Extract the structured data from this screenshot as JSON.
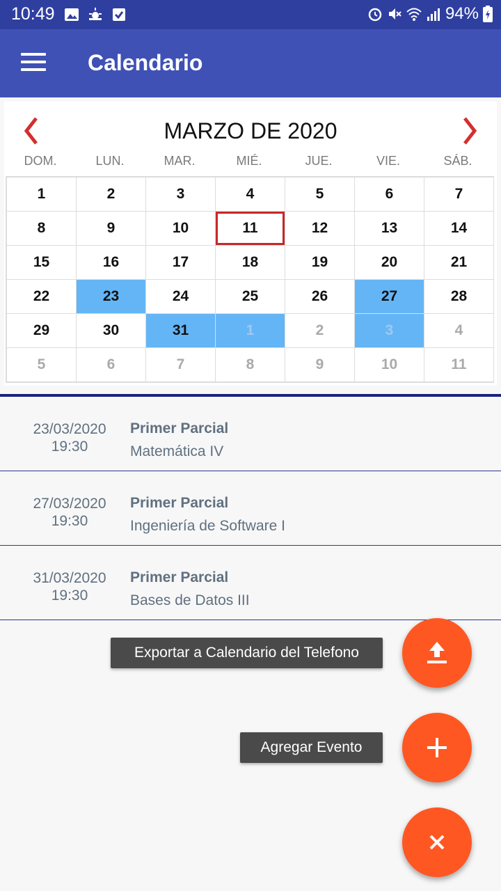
{
  "status_bar": {
    "time": "10:49",
    "battery": "94%",
    "left_icons": [
      "gallery-icon",
      "weather-icon",
      "check-icon"
    ],
    "right_icons": [
      "alarm-icon",
      "mute-icon",
      "wifi-icon",
      "signal-icon",
      "battery-icon"
    ]
  },
  "app_bar": {
    "title": "Calendario",
    "menu_icon": "hamburger-menu-icon",
    "color": "#3f51b5"
  },
  "calendar": {
    "month_label": "MARZO DE 2020",
    "weekdays": [
      "DOM.",
      "LUN.",
      "MAR.",
      "MIÉ.",
      "JUE.",
      "VIE.",
      "SÁB."
    ],
    "selected_day": "11",
    "today_border_color": "#c62828",
    "event_color": "#64b5f6",
    "days": [
      {
        "label": "1",
        "other": false,
        "event": false
      },
      {
        "label": "2",
        "other": false,
        "event": false
      },
      {
        "label": "3",
        "other": false,
        "event": false
      },
      {
        "label": "4",
        "other": false,
        "event": false
      },
      {
        "label": "5",
        "other": false,
        "event": false
      },
      {
        "label": "6",
        "other": false,
        "event": false
      },
      {
        "label": "7",
        "other": false,
        "event": false
      },
      {
        "label": "8",
        "other": false,
        "event": false
      },
      {
        "label": "9",
        "other": false,
        "event": false
      },
      {
        "label": "10",
        "other": false,
        "event": false
      },
      {
        "label": "11",
        "other": false,
        "event": false,
        "today": true
      },
      {
        "label": "12",
        "other": false,
        "event": false
      },
      {
        "label": "13",
        "other": false,
        "event": false
      },
      {
        "label": "14",
        "other": false,
        "event": false
      },
      {
        "label": "15",
        "other": false,
        "event": false
      },
      {
        "label": "16",
        "other": false,
        "event": false
      },
      {
        "label": "17",
        "other": false,
        "event": false
      },
      {
        "label": "18",
        "other": false,
        "event": false
      },
      {
        "label": "19",
        "other": false,
        "event": false
      },
      {
        "label": "20",
        "other": false,
        "event": false
      },
      {
        "label": "21",
        "other": false,
        "event": false
      },
      {
        "label": "22",
        "other": false,
        "event": false
      },
      {
        "label": "23",
        "other": false,
        "event": true
      },
      {
        "label": "24",
        "other": false,
        "event": false
      },
      {
        "label": "25",
        "other": false,
        "event": false
      },
      {
        "label": "26",
        "other": false,
        "event": false
      },
      {
        "label": "27",
        "other": false,
        "event": true
      },
      {
        "label": "28",
        "other": false,
        "event": false
      },
      {
        "label": "29",
        "other": false,
        "event": false
      },
      {
        "label": "30",
        "other": false,
        "event": false
      },
      {
        "label": "31",
        "other": false,
        "event": true
      },
      {
        "label": "1",
        "other": true,
        "event": true
      },
      {
        "label": "2",
        "other": true,
        "event": false
      },
      {
        "label": "3",
        "other": true,
        "event": true
      },
      {
        "label": "4",
        "other": true,
        "event": false
      },
      {
        "label": "5",
        "other": true,
        "event": false
      },
      {
        "label": "6",
        "other": true,
        "event": false
      },
      {
        "label": "7",
        "other": true,
        "event": false
      },
      {
        "label": "8",
        "other": true,
        "event": false
      },
      {
        "label": "9",
        "other": true,
        "event": false
      },
      {
        "label": "10",
        "other": true,
        "event": false
      },
      {
        "label": "11",
        "other": true,
        "event": false
      }
    ]
  },
  "events": [
    {
      "date": "23/03/2020",
      "time": "19:30",
      "title": "Primer Parcial",
      "subject": "Matemática IV"
    },
    {
      "date": "27/03/2020",
      "time": "19:30",
      "title": "Primer Parcial",
      "subject": "Ingeniería de Software I"
    },
    {
      "date": "31/03/2020",
      "time": "19:30",
      "title": "Primer Parcial",
      "subject": "Bases de Datos III"
    }
  ],
  "fab_menu": {
    "export_label": "Exportar a Calendario del Telefono",
    "add_label": "Agregar Evento",
    "fab_color": "#ff5722"
  }
}
